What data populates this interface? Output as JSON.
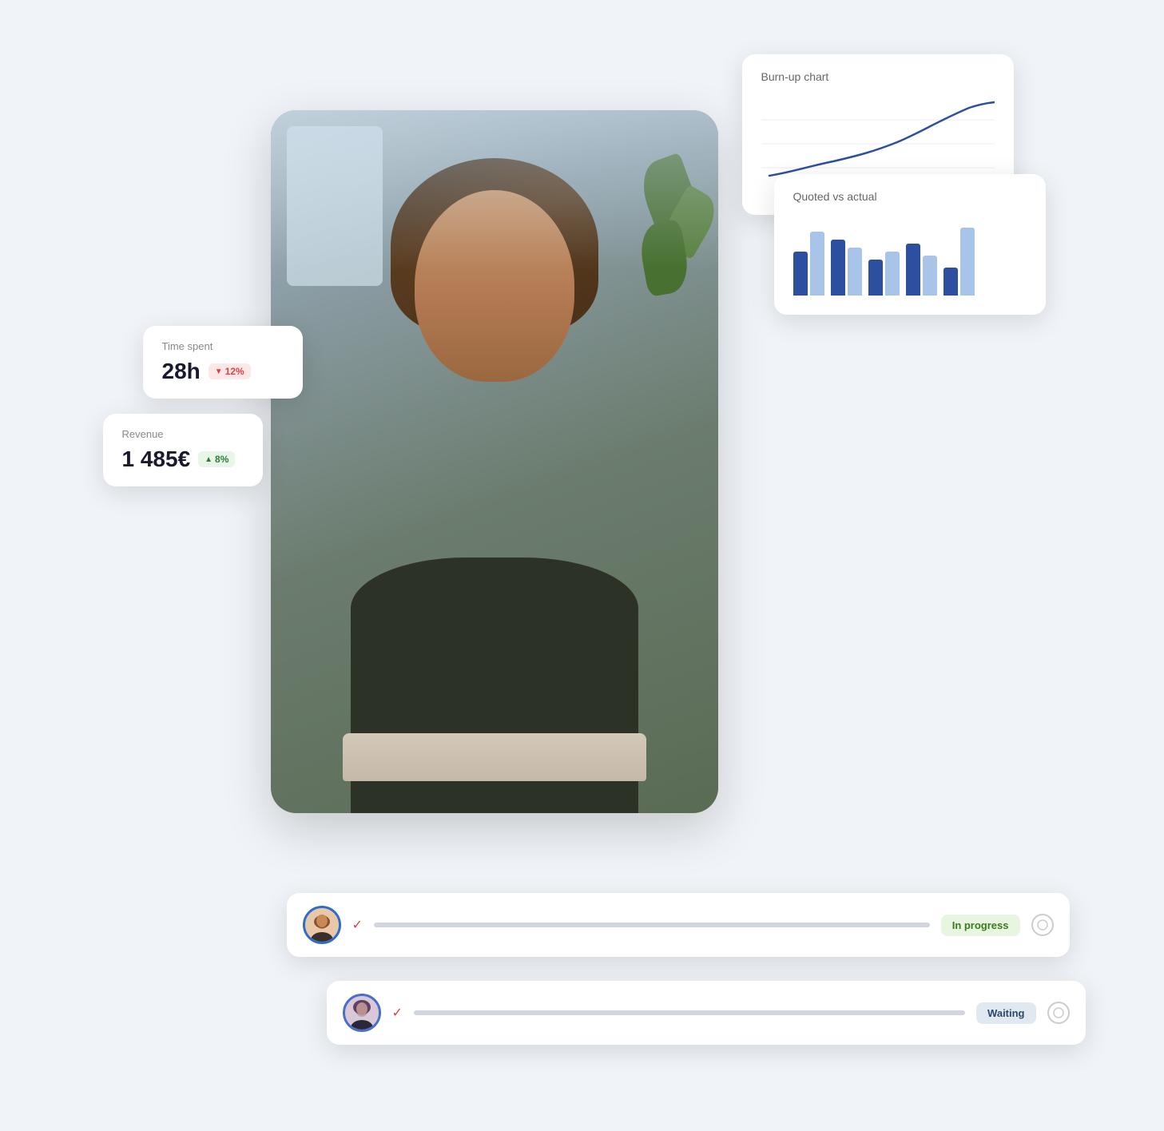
{
  "burn_up_card": {
    "title": "Burn-up chart"
  },
  "quoted_card": {
    "title": "Quoted vs actual",
    "bars": [
      {
        "dark": 55,
        "light": 80
      },
      {
        "dark": 70,
        "light": 60
      },
      {
        "dark": 45,
        "light": 55
      },
      {
        "dark": 65,
        "light": 50
      },
      {
        "dark": 35,
        "light": 85
      }
    ]
  },
  "time_spent_card": {
    "label": "Time spent",
    "value": "28h",
    "badge_label": "12%",
    "badge_type": "red",
    "badge_icon": "▼"
  },
  "revenue_card": {
    "label": "Revenue",
    "value": "1 485€",
    "badge_label": "8%",
    "badge_type": "green",
    "badge_icon": "▲"
  },
  "task_row_1": {
    "status": "In progress",
    "check": "✓",
    "circle_check": "○"
  },
  "task_row_2": {
    "status": "Waiting",
    "check": "✓",
    "circle_check": "○"
  },
  "colors": {
    "accent_blue": "#2d4fa0",
    "accent_light_blue": "#a8c4e8",
    "in_progress_bg": "#e8f5e0",
    "in_progress_text": "#3a7a20",
    "waiting_bg": "#e0e8f0",
    "waiting_text": "#2a4a6a",
    "red_badge": "#e53e3e",
    "green_badge": "#2e7d32"
  }
}
